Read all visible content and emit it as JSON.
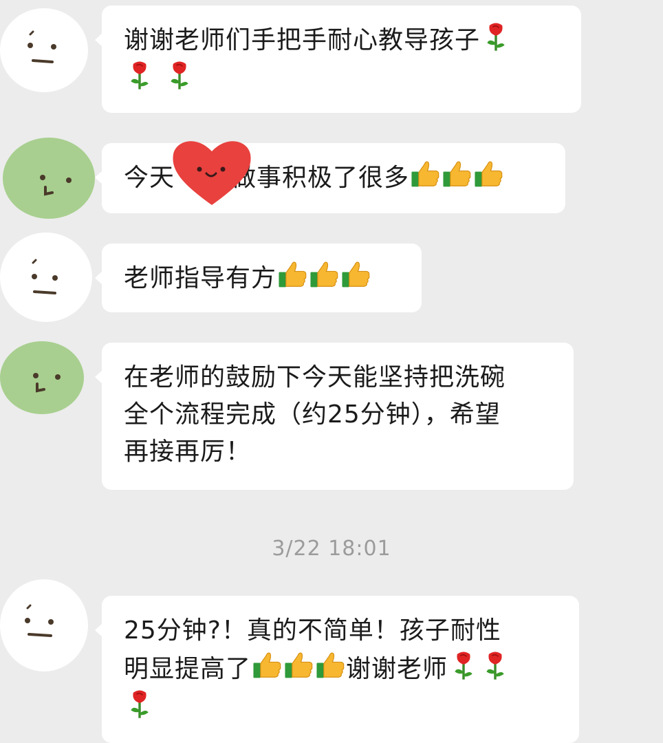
{
  "chat": {
    "messages": [
      {
        "sender": "parent",
        "text_parts": [
          "谢谢老师们手把手耐心教导孩子"
        ],
        "emojis_line1": [
          "rose-icon"
        ],
        "emojis_line2": [
          "rose-icon",
          "rose-icon"
        ]
      },
      {
        "sender": "teacher",
        "text": "今天",
        "text2": "做事积极了很多",
        "emojis": [
          "thumbs-up-icon",
          "thumbs-up-icon",
          "thumbs-up-icon"
        ]
      },
      {
        "sender": "parent",
        "text": "老师指导有方",
        "emojis": [
          "thumbs-up-icon",
          "thumbs-up-icon",
          "thumbs-up-icon"
        ]
      },
      {
        "sender": "teacher",
        "lines": [
          "在老师的鼓励下今天能坚持把洗碗",
          "全个流程完成（约25分钟），希望",
          "再接再厉！"
        ]
      },
      {
        "sender": "parent",
        "line1": "25分钟?！真的不简单！孩子耐性",
        "line2_text": "明显提高了",
        "line2_text_after": "谢谢老师",
        "line2_emojis_thumbs": [
          "thumbs-up-icon",
          "thumbs-up-icon",
          "thumbs-up-icon"
        ],
        "line2_emojis_roses": [
          "rose-icon",
          "rose-icon"
        ],
        "line3_emojis": [
          "rose-icon"
        ]
      }
    ],
    "timestamp": "3/22 18:01"
  },
  "colors": {
    "background": "#ececec",
    "bubble": "#ffffff",
    "timestamp": "#9b9b9b",
    "parent_avatar": "#ffffff",
    "teacher_avatar": "#a8cf8f",
    "heart": "#e8413e"
  }
}
